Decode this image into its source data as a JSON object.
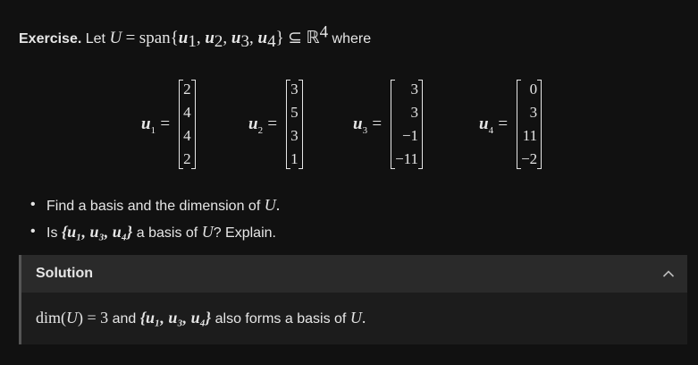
{
  "exercise": {
    "label": "Exercise.",
    "intro": "Let",
    "U": "U",
    "eq": "=",
    "span": "span",
    "open_brace": "{",
    "close_brace": "}",
    "u": "u",
    "subsetof": "⊆",
    "R": "ℝ",
    "R_exp": "4",
    "where": "where"
  },
  "vectors": [
    {
      "name": "u",
      "index": "1",
      "entries": [
        "2",
        "4",
        "4",
        "2"
      ]
    },
    {
      "name": "u",
      "index": "2",
      "entries": [
        "3",
        "5",
        "3",
        "1"
      ]
    },
    {
      "name": "u",
      "index": "3",
      "entries": [
        "3",
        "3",
        "−1",
        "−11"
      ]
    },
    {
      "name": "u",
      "index": "4",
      "entries": [
        "0",
        "3",
        "11",
        "−2"
      ]
    }
  ],
  "tasks": {
    "t1_text": "Find a basis and the dimension of",
    "t1_sym": "U",
    "t1_end": ".",
    "t2_pre": "Is",
    "t2_set": "{u₁, u₃, u₄}",
    "t2_mid": "a basis of",
    "t2_sym": "U",
    "t2_end": "? Explain."
  },
  "solution": {
    "title": "Solution",
    "expanded": true,
    "dim_expr": "dim(",
    "dim_U": "U",
    "dim_close": ") = 3",
    "and": "and",
    "set": "{u₁, u₃, u₄}",
    "rest": "also forms a basis of",
    "rest_U": "U",
    "period": "."
  }
}
